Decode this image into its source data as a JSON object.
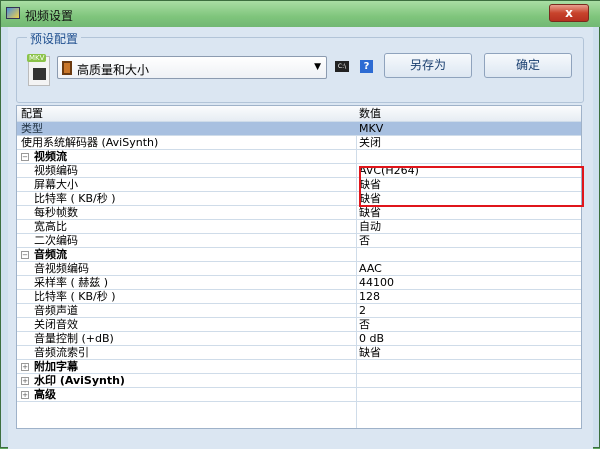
{
  "window": {
    "title": "视频设置",
    "close": "x"
  },
  "preset": {
    "group_label": "预设配置",
    "mkv_tag": "MKV",
    "selected": "高质量和大小",
    "cmd_icon": "C:\\",
    "help": "?",
    "save_as": "另存为",
    "ok": "确定"
  },
  "grid": {
    "headers": [
      "配置",
      "数值"
    ],
    "rows": [
      {
        "k": "类型",
        "v": "MKV",
        "t": "top"
      },
      {
        "k": "使用系统解码器 (AviSynth)",
        "v": "关闭",
        "t": "top"
      },
      {
        "k": "视频流",
        "v": "",
        "t": "cat",
        "e": "−"
      },
      {
        "k": "视频编码",
        "v": "AVC(H264)",
        "t": "sub"
      },
      {
        "k": "屏幕大小",
        "v": "缺省",
        "t": "sub"
      },
      {
        "k": "比特率 ( KB/秒 )",
        "v": "缺省",
        "t": "sub"
      },
      {
        "k": "每秒帧数",
        "v": "缺省",
        "t": "sub"
      },
      {
        "k": "宽高比",
        "v": "自动",
        "t": "sub"
      },
      {
        "k": "二次编码",
        "v": "否",
        "t": "sub"
      },
      {
        "k": "音频流",
        "v": "",
        "t": "cat",
        "e": "−"
      },
      {
        "k": "音视频编码",
        "v": "AAC",
        "t": "sub"
      },
      {
        "k": "采样率 ( 赫兹 )",
        "v": "44100",
        "t": "sub"
      },
      {
        "k": "比特率 ( KB/秒 )",
        "v": "128",
        "t": "sub"
      },
      {
        "k": "音频声道",
        "v": "2",
        "t": "sub"
      },
      {
        "k": "关闭音效",
        "v": "否",
        "t": "sub"
      },
      {
        "k": "音量控制 (+dB)",
        "v": "0 dB",
        "t": "sub"
      },
      {
        "k": "音频流索引",
        "v": "缺省",
        "t": "sub"
      },
      {
        "k": "附加字幕",
        "v": "",
        "t": "cat",
        "e": "+"
      },
      {
        "k": "水印 (AviSynth)",
        "v": "",
        "t": "cat",
        "e": "+"
      },
      {
        "k": "高级",
        "v": "",
        "t": "cat",
        "e": "+"
      }
    ]
  },
  "colors": {
    "highlight": "#e0151b",
    "selection": "#a8c0e0"
  }
}
